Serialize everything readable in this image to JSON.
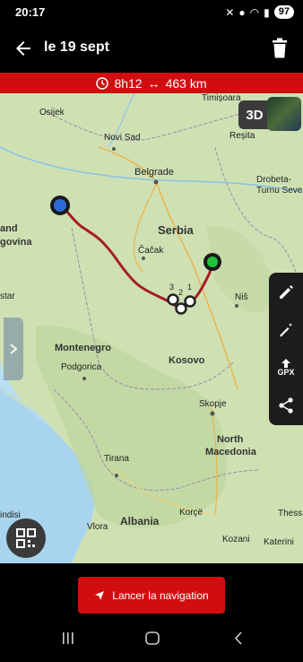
{
  "status_bar": {
    "time": "20:17",
    "battery": "97"
  },
  "header": {
    "title": "le 19 sept"
  },
  "route_info": {
    "duration": "8h12",
    "distance": "463 km"
  },
  "map": {
    "mode_button": "3D",
    "countries": [
      "Serbia",
      "Montenegro",
      "Kosovo",
      "North",
      "Macedonia",
      "Albania"
    ],
    "cities": [
      "Osijek",
      "Timișoara",
      "Novi Sad",
      "Reșita",
      "Belgrade",
      "Drobeta-",
      "Turnu Seve",
      "Čačak",
      "Niš",
      "Podgorica",
      "Skopje",
      "Tirana",
      "Vlora",
      "Korçë",
      "Kozani",
      "Katerini",
      "Thess"
    ],
    "edge_labels": [
      "and",
      "govina",
      "star",
      "indisi"
    ],
    "waypoints": [
      "1",
      "2",
      "3"
    ]
  },
  "tools": {
    "gpx_label": "GPX"
  },
  "actions": {
    "navigate_label": "Lancer la navigation"
  }
}
